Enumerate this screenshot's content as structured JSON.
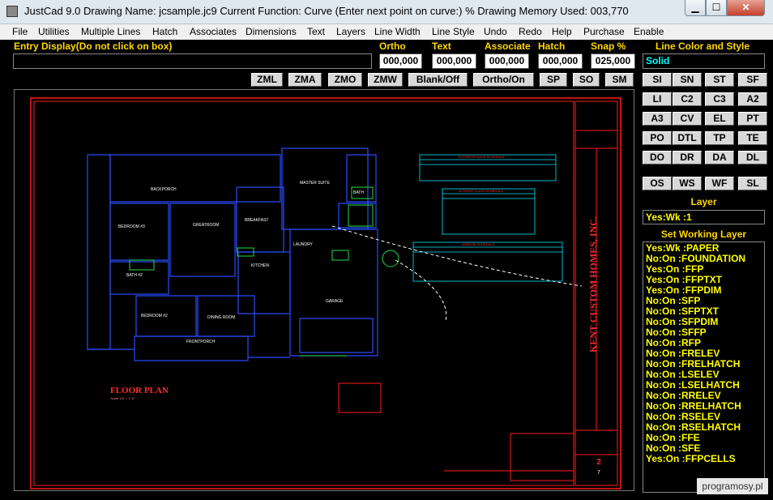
{
  "window": {
    "title": "JustCad 9.0   Drawing Name: jcsample.jc9    Current Function: Curve (Enter next point on curve:)     % Drawing Memory Used: 003,770",
    "min": "▁",
    "max": "☐",
    "close": "✕"
  },
  "menu": [
    "File",
    "Utilities",
    "Multiple Lines",
    "Hatch",
    "Associates",
    "Dimensions",
    "Text",
    "Layers",
    "Line Width",
    "Line Style",
    "Undo",
    "Redo",
    "Help",
    "Purchase",
    "Enable"
  ],
  "labels": {
    "entry_display": "Entry Display(Do not click on box)",
    "ortho": "Ortho",
    "text": "Text",
    "associate": "Associate",
    "hatch": "Hatch",
    "snap": "Snap %",
    "line_color": "Line Color and Style"
  },
  "values": {
    "ortho": "000,000",
    "text": "000,000",
    "associate": "000,000",
    "hatch": "000,000",
    "snap": "025,000",
    "line_color": "Solid"
  },
  "toolbar": [
    "ZML",
    "ZMA",
    "ZMO",
    "ZMW",
    "Blank/Off",
    "Ortho/On",
    "SP",
    "SO",
    "SM"
  ],
  "tools": [
    [
      "SI",
      "SN",
      "ST",
      "SF"
    ],
    [
      "LI",
      "C2",
      "C3",
      "A2"
    ],
    [
      "A3",
      "CV",
      "EL",
      "PT"
    ],
    [
      "PO",
      "DTL",
      "TP",
      "TE"
    ],
    [
      "DO",
      "DR",
      "DA",
      "DL"
    ],
    [
      "OS",
      "WS",
      "WF",
      "SL"
    ]
  ],
  "layer": {
    "title": "Layer",
    "current": "Yes:Wk :1",
    "set_title": "Set Working Layer"
  },
  "layers": [
    "Yes:Wk :PAPER",
    "No:On :FOUNDATION",
    "Yes:On :FFP",
    "Yes:On :FFPTXT",
    "Yes:On :FFPDIM",
    "No:On :SFP",
    "No:On :SFPTXT",
    "No:On :SFPDIM",
    "No:On :SFFP",
    "No:On :RFP",
    "No:On :FRELEV",
    "No:On :FRELHATCH",
    "No:On :LSELEV",
    "No:On :LSELHATCH",
    "No:On :RRELEV",
    "No:On :RRELHATCH",
    "No:On :RSELEV",
    "No:On :RSELHATCH",
    "No:On :FFE",
    "No:On :SFE",
    "Yes:On :FFPCELLS"
  ],
  "drawing": {
    "plan_title": "FLOOR PLAN",
    "scale": "Scale 1/4\" = 1'-0\"",
    "company": "KENT CUSTOM HOMES, INC.",
    "rooms": [
      "BACKPORCH",
      "MASTER SUITE",
      "BEDROOM #3",
      "GREATROOM",
      "BREAKFAST",
      "BATH",
      "LAUNDRY",
      "KITCHEN",
      "BATH #2",
      "GARAGE",
      "BEDROOM #2",
      "DINING ROOM",
      "FRONTPORCH"
    ],
    "schedules": [
      "EXTERIOR DOOR SCHEDULE",
      "INTERIOR DOOR SCHEDULE",
      "WINDOW SCHEDULE"
    ],
    "sheet": "2",
    "sheet_of": "7"
  },
  "watermark": "programosy.pl",
  "colors": {
    "label": "#ffd800",
    "layer_text": "#ffff00",
    "line_style": "#00ffff",
    "plan": "#2a4dff",
    "border": "#ff1a1a"
  }
}
